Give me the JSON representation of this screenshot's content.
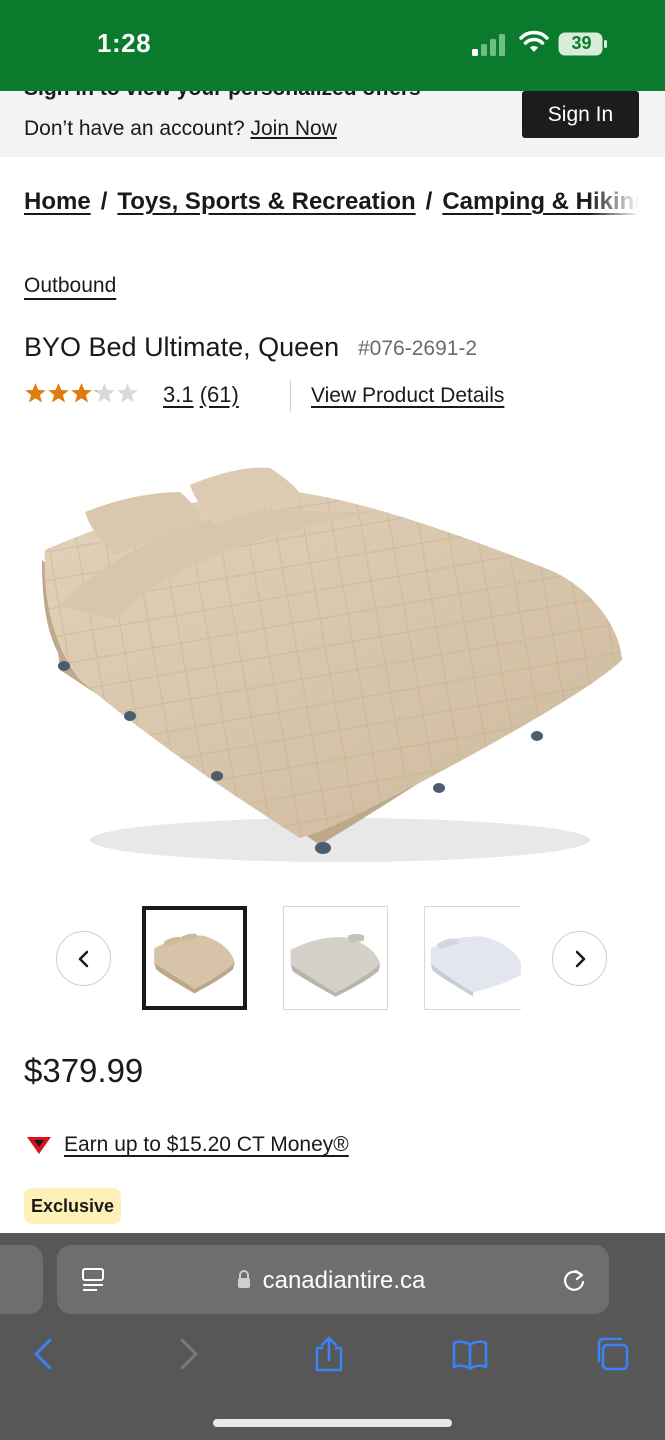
{
  "status_bar": {
    "time": "1:28",
    "battery": "39"
  },
  "signin_banner": {
    "cut_text": "Sign in to view your personalized offers",
    "no_account_text": "Don’t have an account?",
    "join_link": "Join Now",
    "signin_button": "Sign In"
  },
  "breadcrumb": {
    "items": [
      "Home",
      "Toys, Sports & Recreation",
      "Camping & Hiking"
    ],
    "separator": "/"
  },
  "product": {
    "brand": "Outbound",
    "title": "BYO Bed Ultimate, Queen",
    "sku": "#076-2691-2",
    "rating": "3.1",
    "rating_value": 3.1,
    "rating_max": 5,
    "reviews": "(61)",
    "details_link": "View Product Details",
    "price": "$379.99",
    "ct_money": "Earn up to $15.20 CT Money®",
    "badge": "Exclusive"
  },
  "gallery": {
    "thumbnail_count": 3,
    "selected_index": 0
  },
  "browser": {
    "url": "canadiantire.ca"
  },
  "colors": {
    "status_green": "#0a7a2c",
    "star_orange": "#e07b10",
    "ct_red": "#d8141b",
    "badge_yellow": "#fdf1b8",
    "ios_blue": "#2f7bf6"
  },
  "icons": [
    "signal-icon",
    "wifi-icon",
    "battery-icon",
    "star-icon",
    "chevron-left-icon",
    "chevron-right-icon",
    "ct-triangle-icon",
    "reader-icon",
    "lock-icon",
    "reload-icon",
    "back-icon",
    "forward-icon",
    "share-icon",
    "bookmarks-icon",
    "tabs-icon"
  ]
}
